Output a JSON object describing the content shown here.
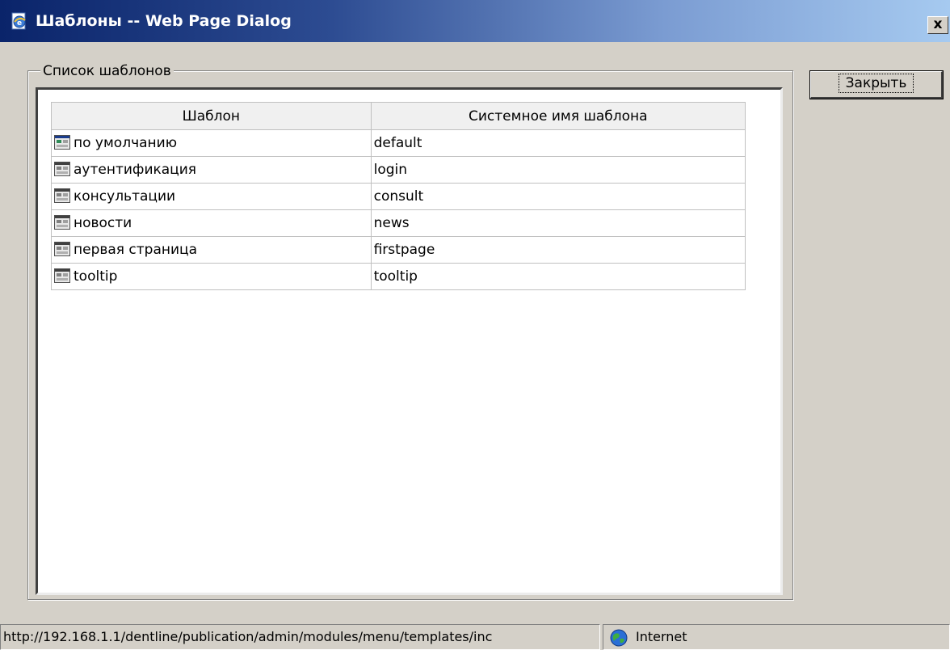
{
  "window": {
    "title": "Шаблоны -- Web Page Dialog",
    "close_glyph": "x"
  },
  "group": {
    "legend": "Список шаблонов"
  },
  "table": {
    "headers": [
      "Шаблон",
      "Системное имя шаблона"
    ],
    "rows": [
      {
        "name": "по умолчанию",
        "system_name": "default",
        "icon": "template-icon-selected"
      },
      {
        "name": "аутентификация",
        "system_name": "login",
        "icon": "template-icon"
      },
      {
        "name": "консультации",
        "system_name": "consult",
        "icon": "template-icon"
      },
      {
        "name": "новости",
        "system_name": "news",
        "icon": "template-icon"
      },
      {
        "name": "первая страница",
        "system_name": "firstpage",
        "icon": "template-icon"
      },
      {
        "name": "tooltip",
        "system_name": "tooltip",
        "icon": "template-icon"
      }
    ]
  },
  "actions": {
    "close_label": "Закрыть"
  },
  "status": {
    "url": "http://192.168.1.1/dentline/publication/admin/modules/menu/templates/inc",
    "zone": "Internet",
    "zone_icon": "globe-icon"
  },
  "colors": {
    "titlebar_start": "#0a246a",
    "titlebar_end": "#a6caf0",
    "dialog_bg": "#d4d0c8"
  }
}
